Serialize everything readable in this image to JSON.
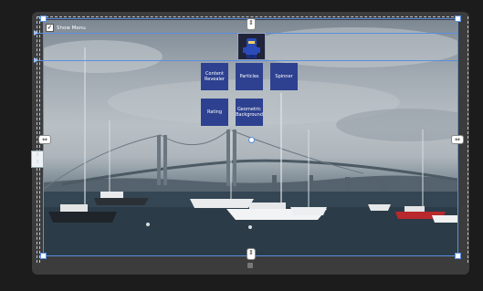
{
  "toolbar": {
    "show_menu_label": "Show Menu",
    "show_menu_checked": true
  },
  "tiles": [
    {
      "line1": "Content",
      "line2": "Revealer"
    },
    {
      "line1": "Particles",
      "line2": ""
    },
    {
      "line1": "Spinner",
      "line2": ""
    },
    {
      "line1": "Rating",
      "line2": ""
    },
    {
      "line1": "Geometric",
      "line2": "Background"
    }
  ],
  "icons": {
    "avatar": "lego-ninja-avatar",
    "resize_handle_top": "resize-handle-icon",
    "resize_handle_left": "resize-handle-icon",
    "resize_handle_right": "resize-handle-icon",
    "resize_handle_bottom": "resize-handle-icon",
    "anchor": "anchor-icon"
  },
  "colors": {
    "tile_bg": "#2d4190",
    "selection": "#5a8fe0",
    "canvas_bg": "#3c3c3c",
    "app_bg": "#1c1c1c"
  }
}
